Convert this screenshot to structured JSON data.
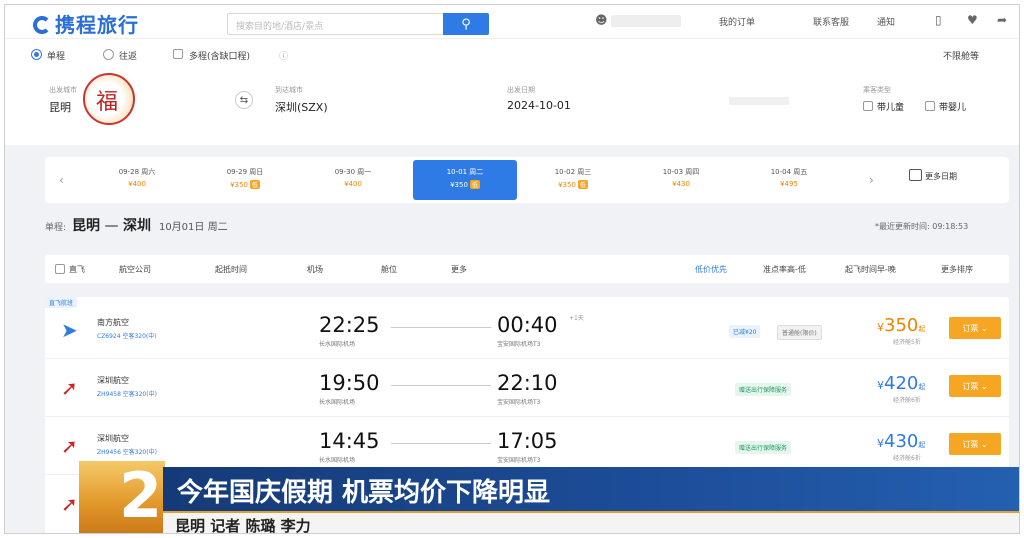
{
  "header": {
    "logo": "携程旅行",
    "search_placeholder": "搜索目的地/酒店/景点",
    "links": [
      "我的订单",
      "联系客服",
      "通知"
    ]
  },
  "trip_type": {
    "options": [
      "单程",
      "往返",
      "多程(含缺口程)"
    ],
    "selected": "单程",
    "right_option": "不限舱等"
  },
  "form": {
    "from_label": "出发城市",
    "from_value": "昆明",
    "to_label": "到达城市",
    "to_value": "深圳(SZX)",
    "date_label": "出发日期",
    "date_value": "2024-10-01",
    "passenger_label": "乘客类型",
    "passengers": [
      "带儿童",
      "带婴儿"
    ]
  },
  "date_strip": {
    "cells": [
      {
        "date": "09-28 周六",
        "price": "¥400",
        "tag": ""
      },
      {
        "date": "09-29 周日",
        "price": "¥350",
        "tag": "低"
      },
      {
        "date": "09-30 周一",
        "price": "¥400",
        "tag": ""
      },
      {
        "date": "10-01 周二",
        "price": "¥350",
        "tag": "低"
      },
      {
        "date": "10-02 周三",
        "price": "¥350",
        "tag": "低"
      },
      {
        "date": "10-03 周四",
        "price": "¥430",
        "tag": ""
      },
      {
        "date": "10-04 周五",
        "price": "¥495",
        "tag": ""
      }
    ],
    "active_index": 3,
    "more_label": "更多日期"
  },
  "route": {
    "prefix": "单程:",
    "from": "昆明",
    "sep": "—",
    "to": "深圳",
    "date": "10月01日 周二",
    "update_text": "*最近更新时间: 09:18:53"
  },
  "filters": {
    "left": [
      "直飞",
      "航空公司",
      "起抵时间",
      "机场",
      "舱位",
      "更多"
    ],
    "right": [
      "低价优先",
      "准点率高-低",
      "起飞时间早-晚",
      "更多排序"
    ]
  },
  "results": {
    "tag": "直飞航班",
    "rows": [
      {
        "airline": "南方航空",
        "flight_no": "CZ6924 空客320(中)",
        "dep_time": "22:25",
        "dep_airport": "长水国际机场",
        "arr_time": "00:40",
        "arr_airport": "宝安国际机场T3",
        "plus_day": "+1天",
        "services": [
          "已减¥20",
          "普通舱(限价)"
        ],
        "price": "350",
        "price_sub": "经济舱5折",
        "book": "订票"
      },
      {
        "airline": "深圳航空",
        "flight_no": "ZH9458 空客320(中)",
        "dep_time": "19:50",
        "dep_airport": "长水国际机场",
        "arr_time": "22:10",
        "arr_airport": "宝安国际机场T3",
        "plus_day": "",
        "services": [
          "赠送出行保障服务"
        ],
        "price": "420",
        "price_sub": "经济舱6折",
        "book": "订票"
      },
      {
        "airline": "深圳航空",
        "flight_no": "ZH9456 空客320(中)",
        "dep_time": "14:45",
        "dep_airport": "长水国际机场",
        "arr_time": "17:05",
        "arr_airport": "宝安国际机场T3",
        "plus_day": "",
        "services": [
          "赠送出行保障服务"
        ],
        "price": "430",
        "price_sub": "经济舱6折",
        "book": "订票"
      }
    ]
  },
  "caption": {
    "number": "2",
    "headline": "今年国庆假期 机票均价下降明显",
    "byline": "昆明 记者 陈璐 李力"
  }
}
